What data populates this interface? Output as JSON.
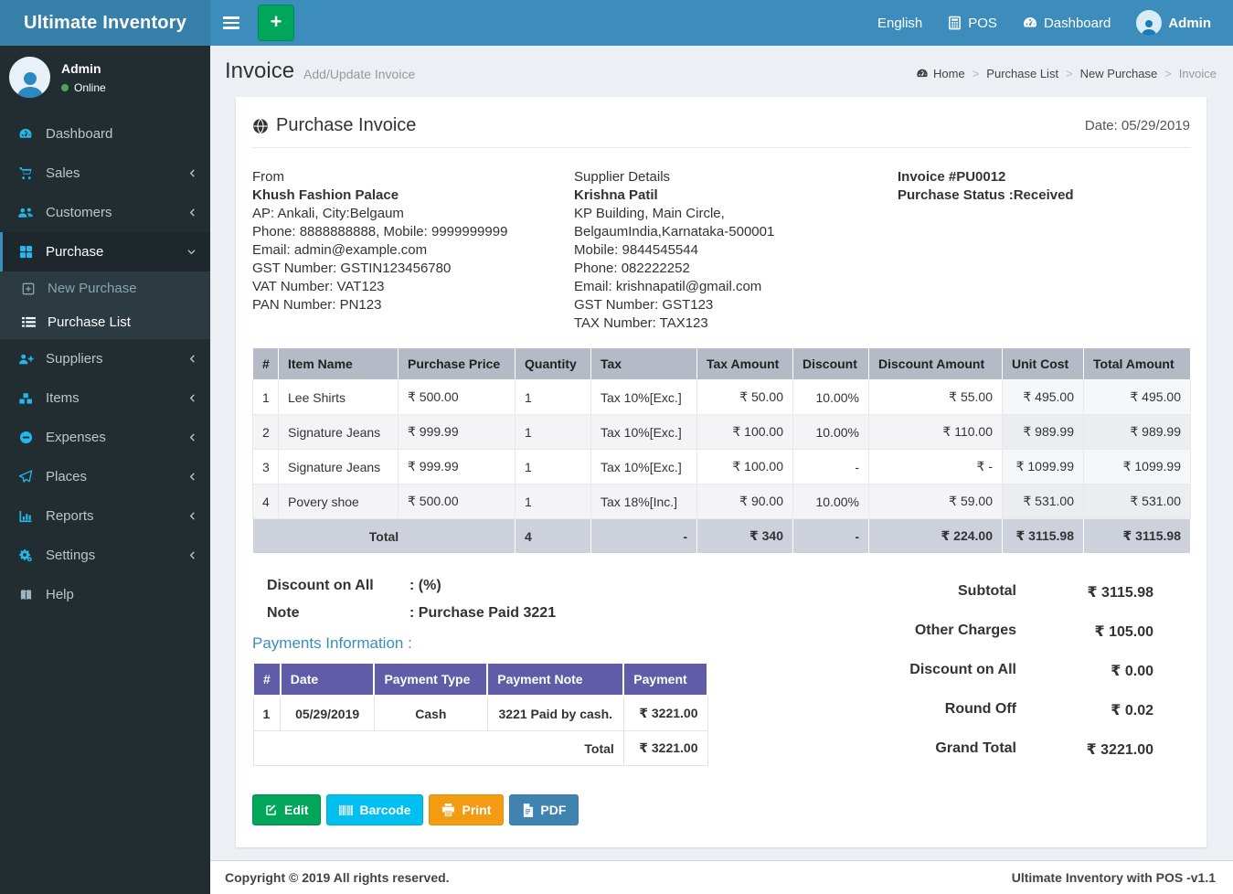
{
  "colors": {
    "navbar": "#3c8dbc",
    "brand-bg": "#367fa9",
    "sidebar-bg": "#222d32",
    "sidebar-active-bg": "#1e282c",
    "submenu-bg": "#2c3b41",
    "icon-cyan": "#24b8ea",
    "green": "#00a65a",
    "cyan": "#00c0ef",
    "orange": "#f39c12",
    "pdf-blue": "#4183b0",
    "purple": "#605ca8",
    "table-header": "#b4bac6",
    "table-total": "#ccd1dc",
    "content-bg": "#ecf0f5",
    "online-green": "#52a352"
  },
  "navbar": {
    "brand": "Ultimate Inventory",
    "language": "English",
    "pos": "POS",
    "dashboard": "Dashboard",
    "user": "Admin"
  },
  "sidebar": {
    "user": {
      "name": "Admin",
      "status": "Online"
    },
    "items": [
      {
        "label": "Dashboard"
      },
      {
        "label": "Sales"
      },
      {
        "label": "Customers"
      },
      {
        "label": "Purchase"
      },
      {
        "label": "Suppliers"
      },
      {
        "label": "Items"
      },
      {
        "label": "Expenses"
      },
      {
        "label": "Places"
      },
      {
        "label": "Reports"
      },
      {
        "label": "Settings"
      },
      {
        "label": "Help"
      }
    ],
    "purchase_submenu": [
      {
        "label": "New Purchase"
      },
      {
        "label": "Purchase List"
      }
    ]
  },
  "page": {
    "title": "Invoice",
    "subtitle": "Add/Update Invoice",
    "breadcrumb": [
      "Home",
      "Purchase List",
      "New Purchase",
      "Invoice"
    ]
  },
  "invoice": {
    "title": "Purchase Invoice",
    "date": "Date: 05/29/2019",
    "from": {
      "heading": "From",
      "name": "Khush Fashion Palace",
      "lines": [
        "AP: Ankali, City:Belgaum",
        "Phone: 8888888888, Mobile: 9999999999",
        "Email: admin@example.com",
        "GST Number: GSTIN123456780",
        "VAT Number: VAT123",
        "PAN Number: PN123"
      ]
    },
    "supplier": {
      "heading": "Supplier Details",
      "name": "Krishna Patil",
      "lines": [
        "KP Building, Main Circle, BelgaumIndia,Karnataka-500001",
        "Mobile: 9844545544",
        "Phone: 082222252",
        "Email: krishnapatil@gmail.com",
        "GST Number: GST123",
        "TAX Number: TAX123"
      ]
    },
    "meta": {
      "invoice_no": "Invoice #PU0012",
      "status": "Purchase Status :Received"
    },
    "items_table": {
      "headers": [
        "#",
        "Item Name",
        "Purchase Price",
        "Quantity",
        "Tax",
        "Tax Amount",
        "Discount",
        "Discount Amount",
        "Unit Cost",
        "Total Amount"
      ],
      "rows": [
        [
          "1",
          "Lee Shirts",
          "₹ 500.00",
          "1",
          "Tax 10%[Exc.]",
          "₹ 50.00",
          "10.00%",
          "₹ 55.00",
          "₹ 495.00",
          "₹ 495.00"
        ],
        [
          "2",
          "Signature Jeans",
          "₹ 999.99",
          "1",
          "Tax 10%[Exc.]",
          "₹ 100.00",
          "10.00%",
          "₹ 110.00",
          "₹ 989.99",
          "₹ 989.99"
        ],
        [
          "3",
          "Signature Jeans",
          "₹ 999.99",
          "1",
          "Tax 10%[Exc.]",
          "₹ 100.00",
          "-",
          "₹ -",
          "₹ 1099.99",
          "₹ 1099.99"
        ],
        [
          "4",
          "Povery shoe",
          "₹ 500.00",
          "1",
          "Tax 18%[Inc.]",
          "₹ 90.00",
          "10.00%",
          "₹ 59.00",
          "₹ 531.00",
          "₹ 531.00"
        ]
      ],
      "total_row": {
        "label": "Total",
        "quantity": "4",
        "tax": "-",
        "tax_amount": "₹ 340",
        "discount": "-",
        "discount_amount": "₹ 224.00",
        "unit_cost": "₹ 3115.98",
        "total_amount": "₹ 3115.98"
      }
    },
    "discount_note": {
      "discount_label": "Discount on All",
      "discount_value": ": (%)",
      "note_label": "Note",
      "note_value": ": Purchase Paid 3221"
    },
    "payments": {
      "title": "Payments Information :",
      "headers": [
        "#",
        "Date",
        "Payment Type",
        "Payment Note",
        "Payment"
      ],
      "rows": [
        [
          "1",
          "05/29/2019",
          "Cash",
          "3221 Paid by cash.",
          "₹ 3221.00"
        ]
      ],
      "total_label": "Total",
      "total_value": "₹ 3221.00"
    },
    "summary": [
      {
        "label": "Subtotal",
        "value": "₹ 3115.98"
      },
      {
        "label": "Other Charges",
        "value": "₹ 105.00"
      },
      {
        "label": "Discount on All",
        "value": "₹ 0.00"
      },
      {
        "label": "Round Off",
        "value": "₹ 0.02"
      },
      {
        "label": "Grand Total",
        "value": "₹ 3221.00"
      }
    ],
    "buttons": [
      {
        "label": "Edit",
        "icon": "edit-icon"
      },
      {
        "label": "Barcode",
        "icon": "barcode-icon"
      },
      {
        "label": "Print",
        "icon": "print-icon"
      },
      {
        "label": "PDF",
        "icon": "pdf-icon"
      }
    ]
  },
  "footer": {
    "left": "Copyright © 2019 All rights reserved.",
    "right": "Ultimate Inventory with POS -v1.1"
  }
}
